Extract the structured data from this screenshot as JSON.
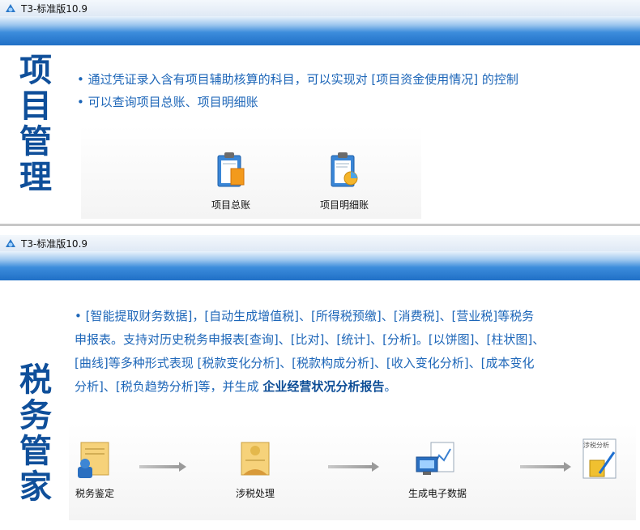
{
  "top_window": {
    "title": "T3-标准版10.9",
    "section_title_chars": [
      "项",
      "目",
      "管",
      "理"
    ],
    "bullets": [
      "通过凭证录入含有项目辅助核算的科目，可以实现对 [项目资金使用情况] 的控制",
      "可以查询项目总账、项目明细账"
    ],
    "icons": [
      {
        "label": "项目总账",
        "icon": "clipboard-ledger-icon"
      },
      {
        "label": "项目明细账",
        "icon": "clipboard-detail-icon"
      }
    ]
  },
  "bottom_window": {
    "title": "T3-标准版10.9",
    "section_title_chars": [
      "税",
      "务",
      "管",
      "家"
    ],
    "paragraph_lines": [
      "[智能提取财务数据]，[自动生成增值税]、[所得税预缴]、[消费税]、[营业税]等税务",
      "申报表。支持对历史税务申报表[查询]、[比对]、[统计]、[分析]。[以饼图]、[柱状图]、",
      "[曲线]等多种形式表现 [税款变化分析]、[税款构成分析]、[收入变化分析]、[成本变化",
      "分析]、[税负趋势分析]等，并生成 "
    ],
    "paragraph_bold": "企业经营状况分析报告",
    "paragraph_end": "。",
    "flow_icons": [
      {
        "label": "税务鉴定",
        "icon": "tax-identify-icon"
      },
      {
        "label": "涉税处理",
        "icon": "tax-process-icon"
      },
      {
        "label": "生成电子数据",
        "icon": "generate-data-icon"
      },
      {
        "label": "",
        "icon": "tax-analysis-icon",
        "badge": "涉税分析"
      }
    ]
  }
}
